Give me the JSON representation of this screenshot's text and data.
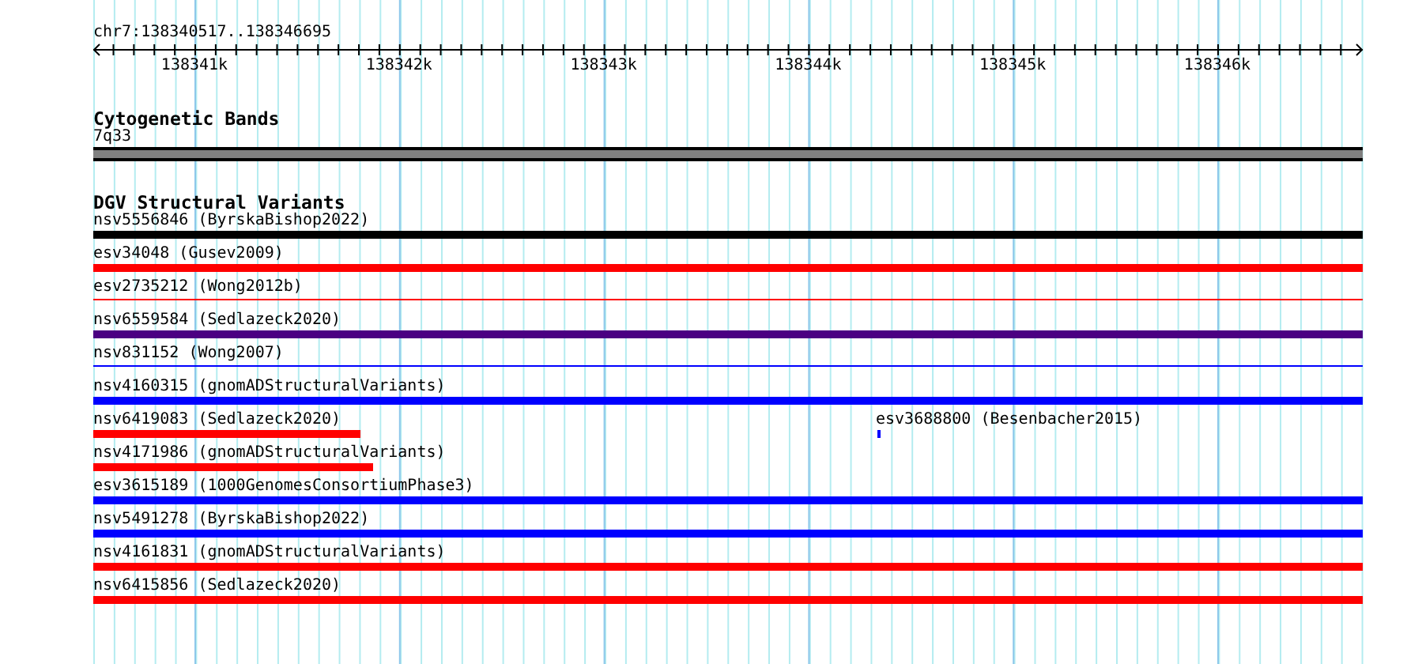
{
  "ruler": {
    "location": "chr7:138340517..138346695",
    "ticks": [
      "138341k",
      "138342k",
      "138343k",
      "138344k",
      "138345k",
      "138346k"
    ]
  },
  "cytobands": {
    "title": "Cytogenetic Bands",
    "band": "7q33"
  },
  "variants": {
    "title": "DGV Structural Variants",
    "lanes": [
      {
        "features": [
          {
            "label": "nsv5556846 (ByrskaBishop2022)",
            "color": "#000000",
            "kind": "bar"
          }
        ]
      },
      {
        "features": [
          {
            "label": "esv34048 (Gusev2009)",
            "color": "#ff0000",
            "kind": "bar"
          }
        ]
      },
      {
        "features": [
          {
            "label": "esv2735212 (Wong2012b)",
            "color": "#ff0000",
            "kind": "line"
          }
        ]
      },
      {
        "features": [
          {
            "label": "nsv6559584 (Sedlazeck2020)",
            "color": "#4b0082",
            "kind": "bar"
          }
        ]
      },
      {
        "features": [
          {
            "label": "nsv831152 (Wong2007)",
            "color": "#0000ff",
            "kind": "line"
          }
        ]
      },
      {
        "features": [
          {
            "label": "nsv4160315 (gnomADStructuralVariants)",
            "color": "#0000ff",
            "kind": "bar"
          }
        ]
      },
      {
        "features": [
          {
            "label": "nsv6419083 (Sedlazeck2020)",
            "color": "#ff0000",
            "kind": "bar",
            "level": 0.21
          },
          {
            "label": "esv3688800 (Besenbacher2015)",
            "color": "#0000ff",
            "kind": "point"
          }
        ]
      },
      {
        "features": [
          {
            "label": "nsv4171986 (gnomADStructuralVariants)",
            "color": "#ff0000",
            "kind": "bar",
            "level": 0.22
          }
        ]
      },
      {
        "features": [
          {
            "label": "esv3615189 (1000GenomesConsortiumPhase3)",
            "color": "#0000ff",
            "kind": "bar"
          }
        ]
      },
      {
        "features": [
          {
            "label": "nsv5491278 (ByrskaBishop2022)",
            "color": "#0000ff",
            "kind": "bar"
          }
        ]
      },
      {
        "features": [
          {
            "label": "nsv4161831 (gnomADStructuralVariants)",
            "color": "#ff0000",
            "kind": "bar"
          }
        ]
      },
      {
        "features": [
          {
            "label": "nsv6415856 (Sedlazeck2020)",
            "color": "#ff0000",
            "kind": "bar"
          }
        ]
      }
    ]
  }
}
